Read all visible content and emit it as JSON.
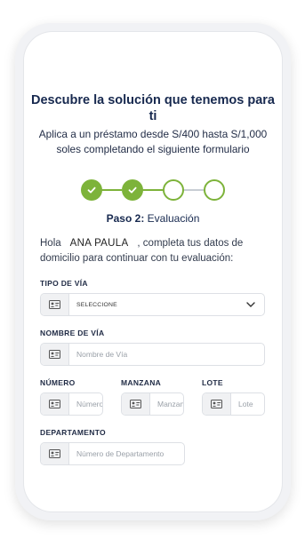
{
  "header": {
    "headline": "Descubre la solución que tenemos para ti",
    "subtitle": "Aplica a un préstamo desde S/400 hasta S/1,000 soles completando el siguiente formulario"
  },
  "stepper": {
    "total_steps": 4,
    "completed_steps": 2,
    "accent_color": "#7db33a",
    "current_step_label": "Paso 2:",
    "current_step_name": "Evaluación"
  },
  "intro": {
    "greeting": "Hola",
    "user_name": "ANA PAULA",
    "message": ", completa tus datos de domicilio para continuar con tu evaluación:"
  },
  "form": {
    "tipo_via": {
      "label": "TIPO DE VÍA",
      "selected": "SELECCIONE",
      "icon": "id-card-icon"
    },
    "nombre_via": {
      "label": "NOMBRE DE VÍA",
      "placeholder": "Nombre de Vía",
      "value": ""
    },
    "numero": {
      "label": "NÚMERO",
      "placeholder": "Número",
      "value": ""
    },
    "manzana": {
      "label": "MANZANA",
      "placeholder": "Manzana",
      "value": ""
    },
    "lote": {
      "label": "LOTE",
      "placeholder": "Lote",
      "value": ""
    },
    "departamento": {
      "label": "DEPARTAMENTO",
      "placeholder": "Número de Departamento",
      "value": ""
    }
  },
  "colors": {
    "headline": "#17294f",
    "field_border": "#dde0e5",
    "icon_bg": "#f0f1f3"
  }
}
